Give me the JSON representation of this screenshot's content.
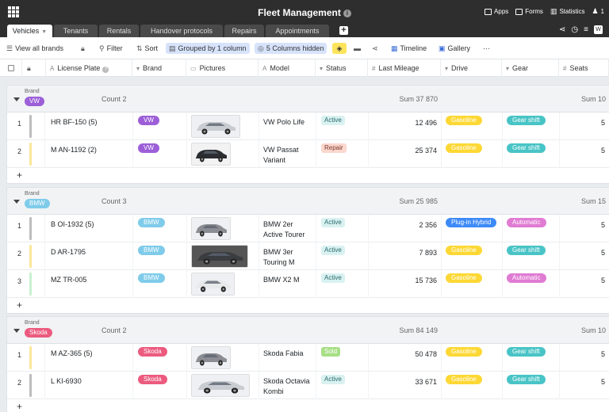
{
  "header": {
    "title": "Fleet Management",
    "info": "i",
    "apps": "Apps",
    "forms": "Forms",
    "statistics": "Statistics",
    "users": "1"
  },
  "tabs": [
    {
      "label": "Vehicles",
      "caret": "▼"
    },
    {
      "label": "Tenants"
    },
    {
      "label": "Rentals"
    },
    {
      "label": "Handover protocols"
    },
    {
      "label": "Repairs"
    },
    {
      "label": "Appointments"
    }
  ],
  "tab_add": "+",
  "tab_right": {
    "share": "⋖",
    "history": "◷",
    "settings": "≡",
    "user": "W"
  },
  "toolbar": {
    "view": "View all brands",
    "filter": "Filter",
    "sort": "Sort",
    "grouped": "Grouped by 1 column",
    "hidden": "5 Columns hidden",
    "timeline": "Timeline",
    "gallery": "Gallery",
    "more": "···"
  },
  "columns": [
    {
      "label": "License Plate",
      "icon": "A",
      "hint": "?"
    },
    {
      "label": "Brand",
      "icon": "▾"
    },
    {
      "label": "Pictures",
      "icon": "▭"
    },
    {
      "label": "Model",
      "icon": "A"
    },
    {
      "label": "Status",
      "icon": "▾"
    },
    {
      "label": "Last Mileage",
      "icon": "#"
    },
    {
      "label": "Drive",
      "icon": "▾"
    },
    {
      "label": "Gear",
      "icon": "▾"
    },
    {
      "label": "Seats",
      "icon": "#"
    }
  ],
  "colors": {
    "vw": "#9c5fd8",
    "bmw": "#7fcbea",
    "skoda": "#ec5b7f",
    "gasoline": "#fdd835",
    "plugin": "#3d8af7",
    "gear_shift": "#49c4c6",
    "automatic": "#e07bd3",
    "active_bg": "#d9f1f1",
    "repair_bg": "#fbd7cf",
    "sold_bg": "#a7df86"
  },
  "groups": [
    {
      "label": "Brand",
      "brand": "VW",
      "brand_color": "#9c5fd8",
      "count": "Count 2",
      "sum_mileage": "Sum 37 870",
      "sum_seats": "Sum 10",
      "rows": [
        {
          "idx": "1",
          "bar": "#bdbdbd",
          "plate": "HR BF-150 (5)",
          "brand": "VW",
          "car": "silver",
          "thumb_w": 60,
          "model": [
            "VW Polo Life",
            ""
          ],
          "status": "Active",
          "status_bg": "#d9f1f1",
          "status_fg": "#2b6b6b",
          "mileage": "12 496",
          "drive": "Gasoline",
          "drive_bg": "#fdd835",
          "gear": "Gear shift",
          "gear_bg": "#49c4c6",
          "seats": "5"
        },
        {
          "idx": "2",
          "bar": "#fbe79a",
          "plate": "M AN-1192 (2)",
          "brand": "VW",
          "car": "black",
          "thumb_w": 48,
          "model": [
            "VW Passat",
            "Variant"
          ],
          "status": "Repair",
          "status_bg": "#fbd7cf",
          "status_fg": "#7a3a2a",
          "mileage": "25 374",
          "drive": "Gasoline",
          "drive_bg": "#fdd835",
          "gear": "Gear shift",
          "gear_bg": "#49c4c6",
          "seats": "5"
        }
      ]
    },
    {
      "label": "Brand",
      "brand": "BMW",
      "brand_color": "#7fcbea",
      "count": "Count 3",
      "sum_mileage": "Sum 25 985",
      "sum_seats": "Sum 15",
      "rows": [
        {
          "idx": "1",
          "bar": "#bdbdbd",
          "plate": "B OI-1932 (5)",
          "brand": "BMW",
          "car": "grey",
          "thumb_w": 48,
          "model": [
            "BMW 2er",
            "Active Tourer"
          ],
          "status": "Active",
          "status_bg": "#d9f1f1",
          "status_fg": "#2b6b6b",
          "mileage": "2 356",
          "drive": "Plug-in Hybrid",
          "drive_bg": "#3d8af7",
          "gear": "Automatic",
          "gear_bg": "#e07bd3",
          "seats": "5"
        },
        {
          "idx": "2",
          "bar": "#fbe79a",
          "plate": "D AR-1795",
          "brand": "BMW",
          "car": "dark",
          "thumb_w": 70,
          "model": [
            "BMW 3er",
            "Touring M"
          ],
          "status": "Active",
          "status_bg": "#d9f1f1",
          "status_fg": "#2b6b6b",
          "mileage": "7 893",
          "drive": "Gasoline",
          "drive_bg": "#fdd835",
          "gear": "Gear shift",
          "gear_bg": "#49c4c6",
          "seats": "5"
        },
        {
          "idx": "3",
          "bar": "#c8f0cf",
          "plate": "MZ TR-005",
          "brand": "BMW",
          "car": "white",
          "thumb_w": 53,
          "model": [
            "BMW X2 M",
            ""
          ],
          "status": "Active",
          "status_bg": "#d9f1f1",
          "status_fg": "#2b6b6b",
          "mileage": "15 736",
          "drive": "Gasoline",
          "drive_bg": "#fdd835",
          "gear": "Automatic",
          "gear_bg": "#e07bd3",
          "seats": "5"
        }
      ]
    },
    {
      "label": "Brand",
      "brand": "Skoda",
      "brand_color": "#ec5b7f",
      "count": "Count 2",
      "sum_mileage": "Sum 84 149",
      "sum_seats": "Sum 10",
      "rows": [
        {
          "idx": "1",
          "bar": "#fbe79a",
          "plate": "M AZ-365 (5)",
          "brand": "Skoda",
          "car": "grey",
          "thumb_w": 48,
          "model": [
            "Skoda Fabia",
            ""
          ],
          "status": "Sold",
          "status_bg": "#a7df86",
          "status_fg": "#ffffff",
          "mileage": "50 478",
          "drive": "Gasoline",
          "drive_bg": "#fdd835",
          "gear": "Gear shift",
          "gear_bg": "#49c4c6",
          "seats": "5"
        },
        {
          "idx": "2",
          "bar": "#bdbdbd",
          "plate": "L KI-6930",
          "brand": "Skoda",
          "car": "silver",
          "thumb_w": 72,
          "model": [
            "Skoda Octavia",
            "Kombi"
          ],
          "status": "Active",
          "status_bg": "#d9f1f1",
          "status_fg": "#2b6b6b",
          "mileage": "33 671",
          "drive": "Gasoline",
          "drive_bg": "#fdd835",
          "gear": "Gear shift",
          "gear_bg": "#49c4c6",
          "seats": "5"
        }
      ]
    }
  ],
  "add_row": "+"
}
